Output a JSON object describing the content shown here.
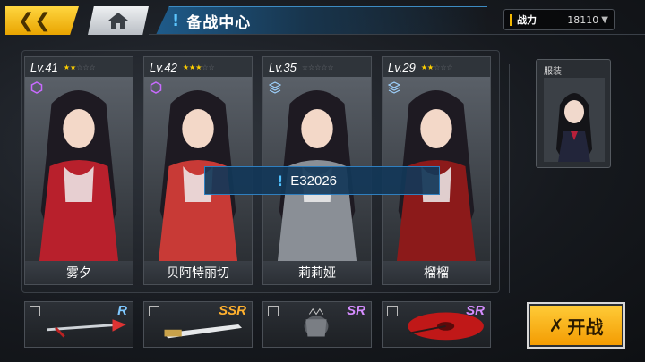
{
  "topbar": {
    "back_icon": "double-chevron-left-icon",
    "home_icon": "home-icon",
    "title": "备战中心",
    "power_label": "战力",
    "power_value": "18110"
  },
  "tooltip": {
    "text": "E32026"
  },
  "costume": {
    "label": "服装"
  },
  "cards": [
    {
      "level": "Lv.41",
      "stars_filled": 2,
      "stars_total": 5,
      "name": "雾夕",
      "role": "hexagon-outline",
      "accent": "#b8202c"
    },
    {
      "level": "Lv.42",
      "stars_filled": 3,
      "stars_total": 5,
      "name": "贝阿特丽切",
      "role": "hexagon-outline",
      "accent": "#c83a36"
    },
    {
      "level": "Lv.35",
      "stars_filled": 0,
      "stars_total": 5,
      "name": "莉莉娅",
      "role": "layers",
      "accent": "#8a8f96"
    },
    {
      "level": "Lv.29",
      "stars_filled": 2,
      "stars_total": 5,
      "name": "榴榴",
      "role": "layers",
      "accent": "#8c1a1a"
    }
  ],
  "weapons": [
    {
      "rarity": "R",
      "kind": "spear"
    },
    {
      "rarity": "SSR",
      "kind": "sword"
    },
    {
      "rarity": "SR",
      "kind": "gauntlet"
    },
    {
      "rarity": "SR",
      "kind": "umbrella"
    }
  ],
  "start_button": {
    "label": "开战",
    "icon": "crossed-swords-icon"
  }
}
